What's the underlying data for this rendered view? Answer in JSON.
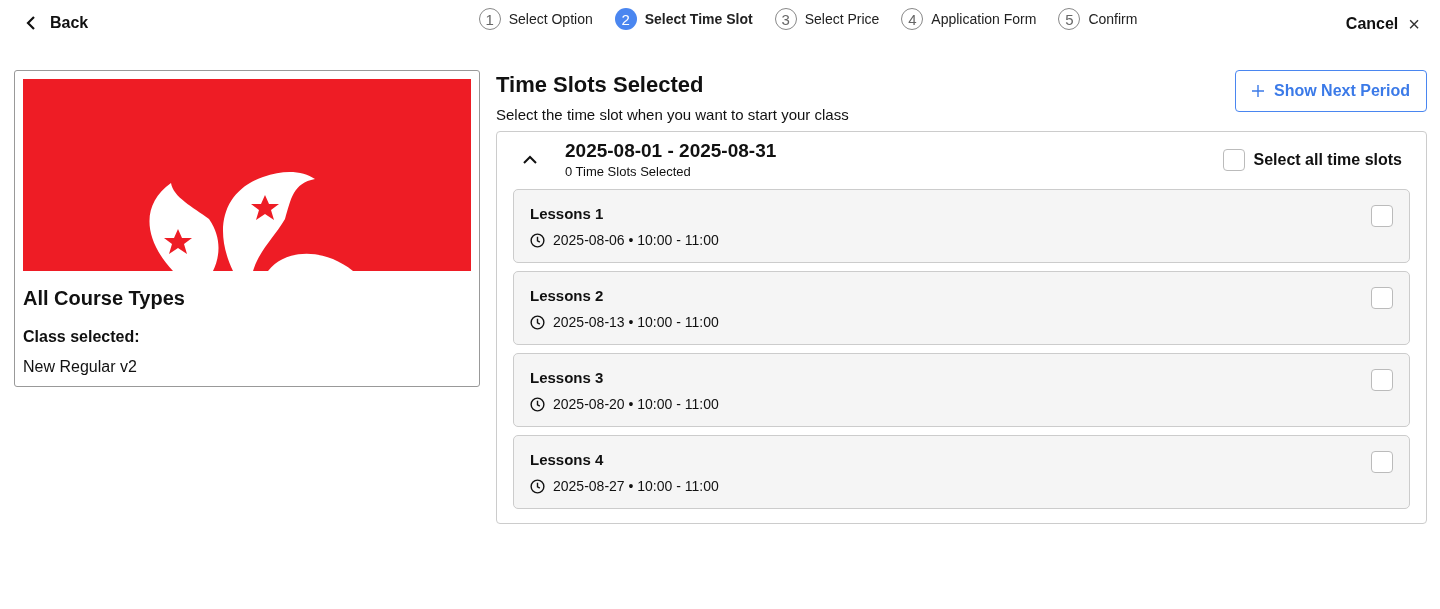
{
  "header": {
    "back": "Back",
    "cancel": "Cancel",
    "close": "×"
  },
  "steps": [
    {
      "number": "1",
      "label": "Select Option",
      "selected": false
    },
    {
      "number": "2",
      "label": "Select Time Slot",
      "selected": true
    },
    {
      "number": "3",
      "label": "Select Price",
      "selected": false
    },
    {
      "number": "4",
      "label": "Application Form",
      "selected": false
    },
    {
      "number": "5",
      "label": "Confirm",
      "selected": false
    }
  ],
  "course": {
    "title": "All Course Types",
    "class_label": "Class selected:",
    "class_value": "New Regular v2"
  },
  "main": {
    "title": "Time Slots Selected",
    "subtitle": "Select the time slot when you want to start your class",
    "next_button": "Show Next Period"
  },
  "period": {
    "range": "2025-08-01 - 2025-08-31",
    "count": "0 Time Slots Selected",
    "expanded": true,
    "select_all": {
      "label": "Select all time slots",
      "checked": false
    },
    "slots": [
      {
        "name": "Lessons 1",
        "time": "2025-08-06 • 10:00 - 11:00",
        "checked": false
      },
      {
        "name": "Lessons 2",
        "time": "2025-08-13 • 10:00 - 11:00",
        "checked": false
      },
      {
        "name": "Lessons 3",
        "time": "2025-08-20 • 10:00 - 11:00",
        "checked": false
      },
      {
        "name": "Lessons 4",
        "time": "2025-08-27 • 10:00 - 11:00",
        "checked": false
      }
    ]
  }
}
